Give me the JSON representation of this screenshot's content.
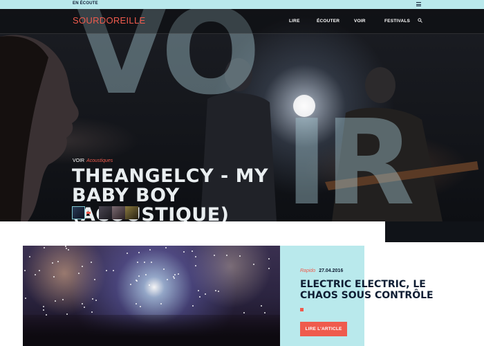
{
  "topbar": {
    "now_playing": "EN ÉCOUTE",
    "menu_icon": "list-icon"
  },
  "nav": {
    "logo": "SOURDOREILLE",
    "links": [
      "LIRE",
      "ÉCOUTER",
      "VOIR",
      "FESTIVALS"
    ],
    "search_icon": "search-icon"
  },
  "hero": {
    "big_word_top": "VO",
    "big_word_bottom": "IR",
    "category": "VOIR",
    "subcategory": "Acoustiques",
    "title": "THEANGELCY - MY BABY BOY (ACOUSTIQUE)",
    "accent_color": "#ef5b4d"
  },
  "article": {
    "tag": "Rapido",
    "date": "27.04.2016",
    "title": "ELECTRIC ELECTRIC, LE CHAOS SOUS CONTRÔLE",
    "button": "LIRE L'ARTICLE",
    "panel_color": "#b9e9ec"
  }
}
